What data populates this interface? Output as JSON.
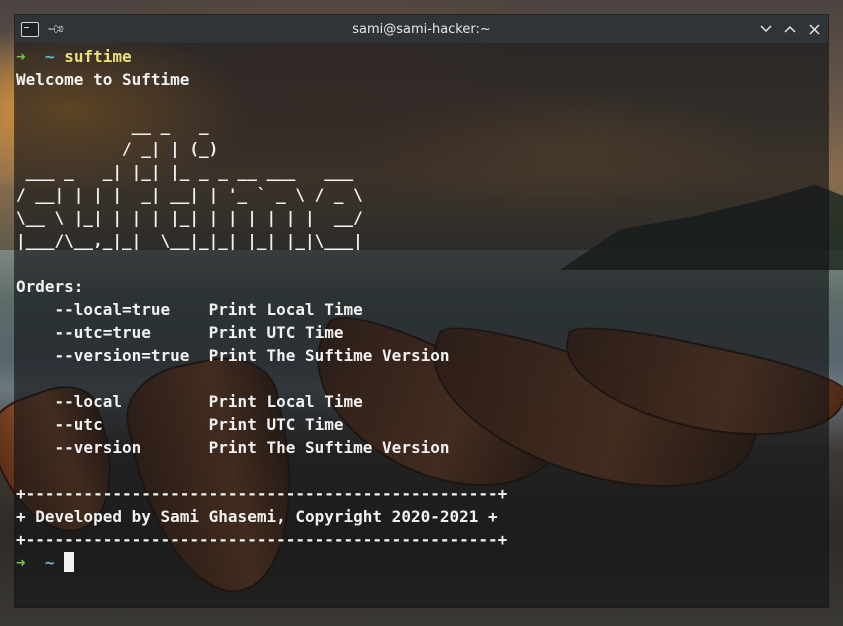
{
  "window": {
    "title": "sami@sami-hacker:~"
  },
  "terminal": {
    "prompt_arrow": "➜",
    "prompt_dir": "~",
    "command": "suftime",
    "welcome": "Welcome to Suftime",
    "ascii_art": [
      "            __ _   _",
      "           / _| | (_)",
      " ___ _   _| |_| |_ _ _ __ ___   ___",
      "/ __| | | |  _| __| | '_ ` _ \\ / _ \\",
      "\\__ \\ |_| | | | |_| | | | | | |  __/",
      "|___/\\__,_|_|  \\__|_|_| |_| |_|\\___|"
    ],
    "orders_heading": "Orders:",
    "orders_block1": [
      {
        "flag": "    --local=true    ",
        "desc": "Print Local Time"
      },
      {
        "flag": "    --utc=true      ",
        "desc": "Print UTC Time"
      },
      {
        "flag": "    --version=true  ",
        "desc": "Print The Suftime Version"
      }
    ],
    "orders_block2": [
      {
        "flag": "    --local         ",
        "desc": "Print Local Time"
      },
      {
        "flag": "    --utc           ",
        "desc": "Print UTC Time"
      },
      {
        "flag": "    --version       ",
        "desc": "Print The Suftime Version"
      }
    ],
    "border_line": "+-------------------------------------------------+",
    "footer_text": "+ Developed by Sami Ghasemi, Copyright 2020-2021 +"
  },
  "colors": {
    "titlebar": "#2f3438",
    "prompt_arrow": "#7ec14a",
    "prompt_dir": "#6fb7d8",
    "command": "#ece07a",
    "text": "#f2f2f2"
  },
  "icons": {
    "app": "terminal-icon",
    "pin": "pin-icon",
    "minimize": "chevron-down-icon",
    "maximize": "chevron-up-icon",
    "close": "close-icon"
  }
}
